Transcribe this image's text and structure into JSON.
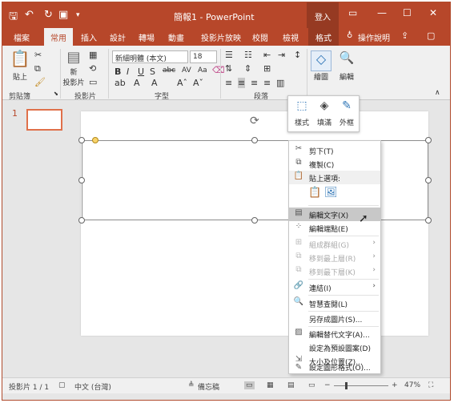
{
  "title": "簡報1 - PowerPoint",
  "signin": "登入",
  "tabs": [
    "檔案",
    "常用",
    "插入",
    "設計",
    "轉場",
    "動畫",
    "投影片放映",
    "校閱",
    "檢視",
    "格式"
  ],
  "tell_me": "操作說明",
  "ribbon": {
    "paste": "貼上",
    "new_slide_1": "新",
    "new_slide_2": "投影片",
    "font_name": "新細明體 (本文)",
    "font_size": "18",
    "drawing": "繪圖",
    "editing": "編輯",
    "groups": [
      "剪貼簿",
      "投影片",
      "字型",
      "段落"
    ]
  },
  "style_gallery": [
    "樣式",
    "填滿",
    "外框"
  ],
  "thumbnail_number": "1",
  "context_menu": {
    "cut": "剪下(T)",
    "copy": "複製(C)",
    "paste_options": "貼上選項:",
    "edit_text": "編輯文字(X)",
    "edit_points": "編輯端點(E)",
    "group": "組成群組(G)",
    "bring_forward": "移到最上層(R)",
    "send_backward": "移到最下層(K)",
    "link": "連結(I)",
    "smart_lookup": "智慧查閱(L)",
    "save_as_picture": "另存成圖片(S)...",
    "edit_alt_text": "編輯替代文字(A)...",
    "set_default_shape": "設定為預設圖案(D)",
    "size_position": "大小及位置(Z)...",
    "format_shape": "設定圖形格式(O)..."
  },
  "status": {
    "slide": "投影片 1 / 1",
    "language": "中文 (台灣)",
    "notes": "備忘稿",
    "zoom": "47%"
  },
  "colors": {
    "accent": "#b7472a",
    "ribbon_bg": "#f0f0f0",
    "workspace": "#e6e6e6"
  }
}
